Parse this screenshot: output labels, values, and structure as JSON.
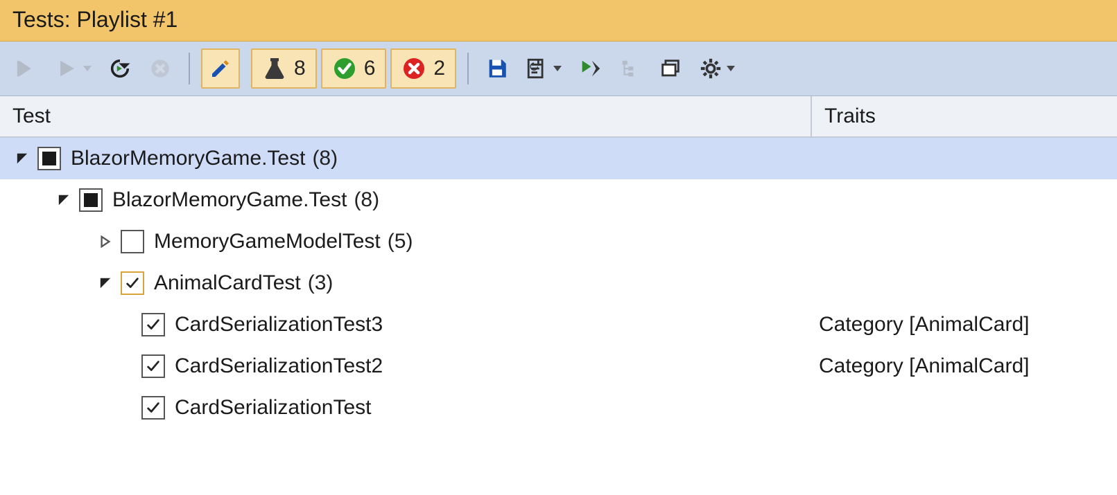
{
  "title": "Tests: Playlist #1",
  "toolbar": {
    "counts": {
      "total": 8,
      "passed": 6,
      "failed": 2
    }
  },
  "columns": {
    "test": "Test",
    "traits": "Traits"
  },
  "tree": {
    "root": {
      "name": "BlazorMemoryGame.Test",
      "count": "(8)",
      "child": {
        "name": "BlazorMemoryGame.Test",
        "count": "(8)",
        "g1": {
          "name": "MemoryGameModelTest",
          "count": "(5)"
        },
        "g2": {
          "name": "AnimalCardTest",
          "count": "(3)",
          "t1": {
            "name": "CardSerializationTest3",
            "traits": "Category [AnimalCard]"
          },
          "t2": {
            "name": "CardSerializationTest2",
            "traits": "Category [AnimalCard]"
          },
          "t3": {
            "name": "CardSerializationTest",
            "traits": ""
          }
        }
      }
    }
  }
}
